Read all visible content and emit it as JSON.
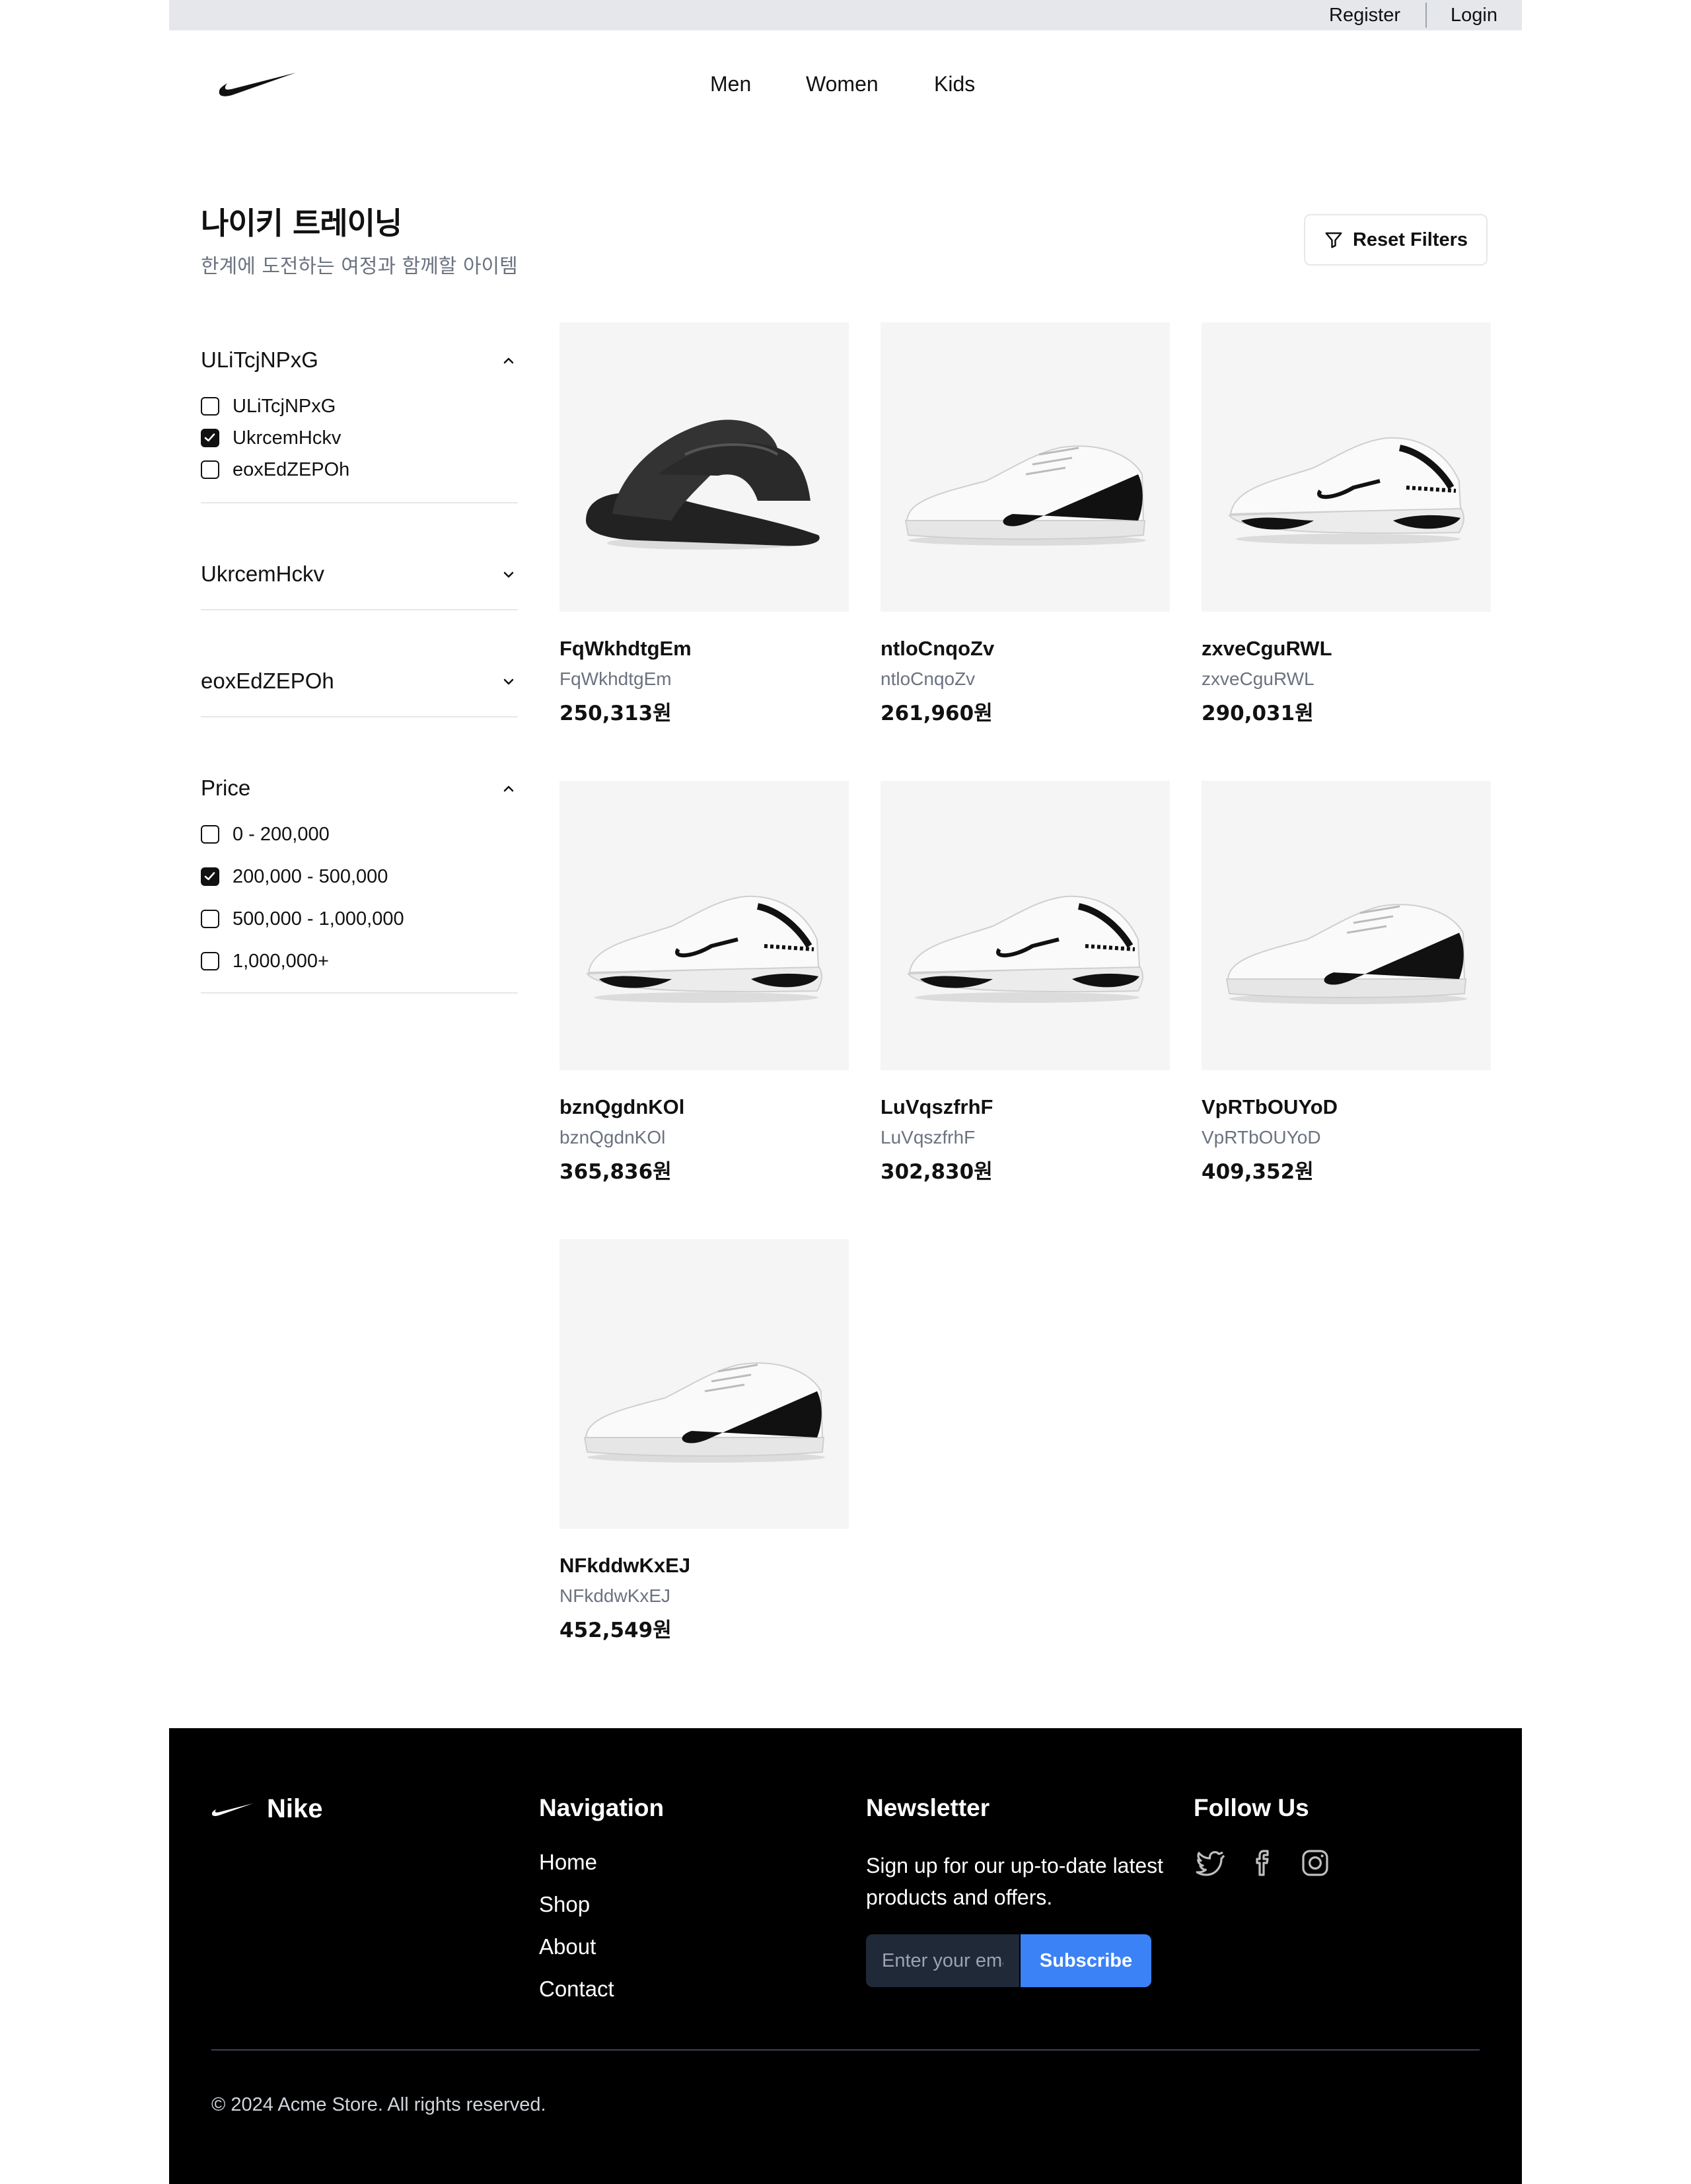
{
  "topbar": {
    "register": "Register",
    "login": "Login"
  },
  "header": {
    "logo_icon": "nike-swoosh-icon",
    "nav": [
      "Men",
      "Women",
      "Kids"
    ]
  },
  "page": {
    "title": "나이키 트레이닝",
    "subtitle": "한계에 도전하는 여정과 함께할 아이템",
    "reset_label": "Reset Filters",
    "reset_icon": "filter-icon"
  },
  "filters": {
    "groups": [
      {
        "title": "ULiTcjNPxG",
        "expanded": true,
        "options": [
          {
            "label": "ULiTcjNPxG",
            "checked": false
          },
          {
            "label": "UkrcemHckv",
            "checked": true
          },
          {
            "label": "eoxEdZEPOh",
            "checked": false
          }
        ]
      },
      {
        "title": "UkrcemHckv",
        "expanded": false,
        "options": []
      },
      {
        "title": "eoxEdZEPOh",
        "expanded": false,
        "options": []
      },
      {
        "title": "Price",
        "expanded": true,
        "options": [
          {
            "label": "0 - 200,000",
            "checked": false
          },
          {
            "label": "200,000 - 500,000",
            "checked": true
          },
          {
            "label": "500,000 - 1,000,000",
            "checked": false
          },
          {
            "label": "1,000,000+",
            "checked": false
          }
        ]
      }
    ]
  },
  "products": [
    {
      "name": "FqWkhdtgEm",
      "category": "FqWkhdtgEm",
      "price": "250,313원",
      "image": "black-slide-sandal"
    },
    {
      "name": "ntloCnqoZv",
      "category": "ntloCnqoZv",
      "price": "261,960원",
      "image": "white-court-sneaker"
    },
    {
      "name": "zxveCguRWL",
      "category": "zxveCguRWL",
      "price": "290,031원",
      "image": "white-running-sneaker"
    },
    {
      "name": "bznQgdnKOl",
      "category": "bznQgdnKOl",
      "price": "365,836원",
      "image": "white-running-sneaker"
    },
    {
      "name": "LuVqszfrhF",
      "category": "LuVqszfrhF",
      "price": "302,830원",
      "image": "white-running-sneaker"
    },
    {
      "name": "VpRTbOUYoD",
      "category": "VpRTbOUYoD",
      "price": "409,352원",
      "image": "white-court-sneaker"
    },
    {
      "name": "NFkddwKxEJ",
      "category": "NFkddwKxEJ",
      "price": "452,549원",
      "image": "white-court-sneaker"
    }
  ],
  "footer": {
    "brand": "Nike",
    "navigation": {
      "title": "Navigation",
      "links": [
        "Home",
        "Shop",
        "About",
        "Contact"
      ]
    },
    "newsletter": {
      "title": "Newsletter",
      "text": "Sign up for our up-to-date latest products and offers.",
      "placeholder": "Enter your email",
      "button": "Subscribe"
    },
    "social": {
      "title": "Follow Us",
      "icons": [
        "twitter-icon",
        "facebook-icon",
        "instagram-icon"
      ]
    },
    "copyright": "© 2024 Acme Store. All rights reserved."
  },
  "colors": {
    "accent": "#3b82f6",
    "footer_bg": "#000000",
    "topbar_bg": "#e5e7eb",
    "card_bg": "#f5f5f5"
  }
}
